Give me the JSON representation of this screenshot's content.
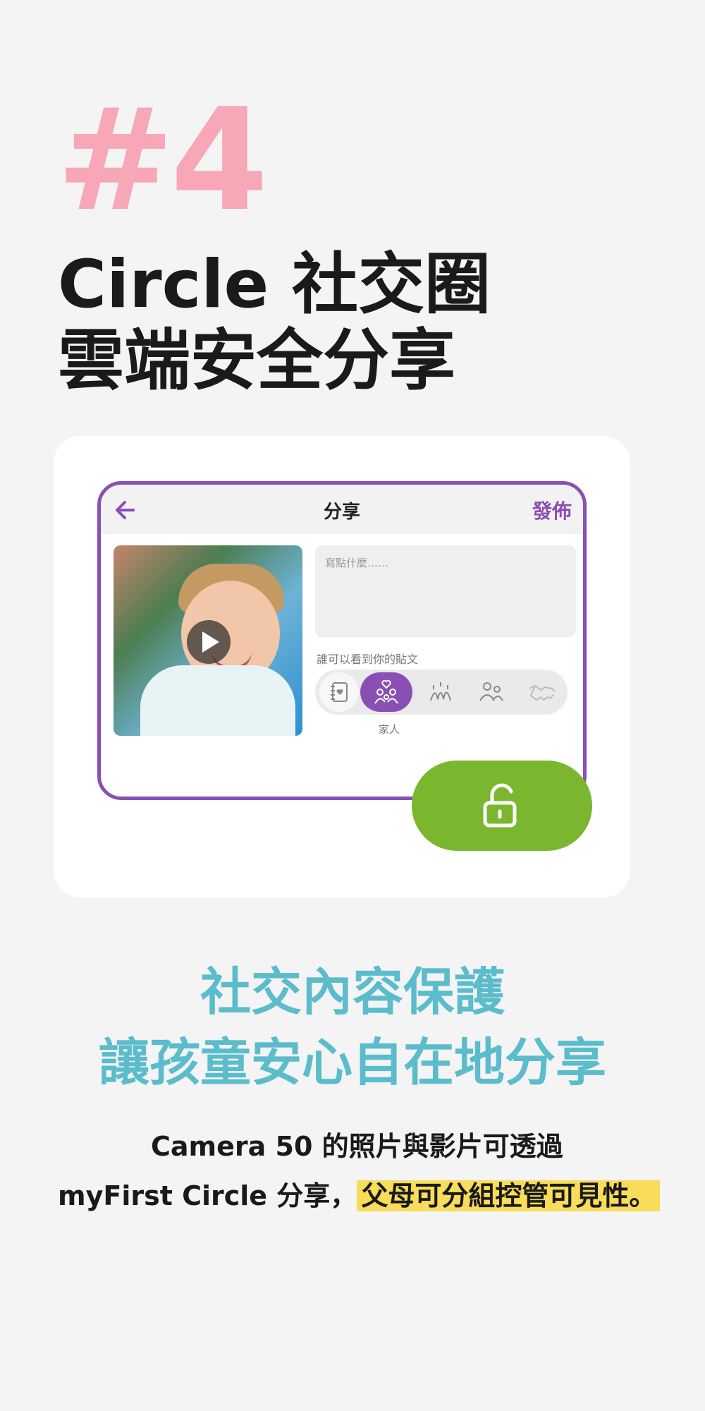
{
  "hero": {
    "number": "#4",
    "title_line1": "Circle 社交圈",
    "title_line2": "雲端安全分享"
  },
  "share_screen": {
    "title": "分享",
    "publish_label": "發佈",
    "caption_placeholder": "寫點什麼……",
    "visibility_label": "誰可以看到你的貼文",
    "selected_audience": "家人",
    "audience_options": [
      "diary-icon",
      "family-icon",
      "friends-icon",
      "group-icon",
      "handshake-icon"
    ],
    "back_icon": "arrow-left-icon",
    "lock_icon": "unlock-icon",
    "colors": {
      "accent": "#8a4fb4",
      "lock_button": "#7ab72e"
    }
  },
  "subheading": {
    "line1": "社交內容保護",
    "line2": "讓孩童安心自在地分享"
  },
  "body": {
    "line1": "Camera 50 的照片與影片可透過",
    "line2_plain": "myFirst Circle 分享，",
    "line2_highlight": "父母可分組控管可見性。"
  },
  "colors": {
    "hero_number": "#f7a7b6",
    "subheading": "#5bbccb",
    "highlight": "#f8dc5a"
  }
}
